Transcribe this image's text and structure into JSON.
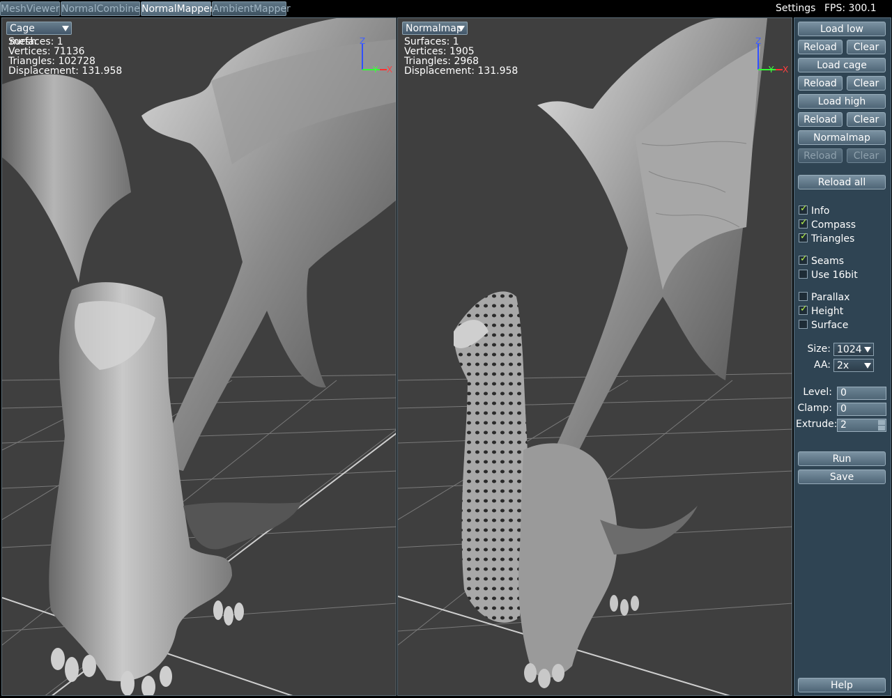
{
  "tabs": [
    {
      "label": "MeshViewer",
      "active": false
    },
    {
      "label": "NormalCombiner",
      "active": false
    },
    {
      "label": "NormalMapper",
      "active": true
    },
    {
      "label": "AmbientMapper",
      "active": false
    }
  ],
  "topbar": {
    "settings_label": "Settings",
    "fps_label": "FPS: 300.1"
  },
  "viewports": {
    "left": {
      "mode": "Cage mesh",
      "info": [
        "Surfaces: 1",
        "Vertices: 71136",
        "Triangles: 102728",
        "Displacement: 131.958"
      ],
      "scene_icon": "dragon-cage-mesh-render"
    },
    "right": {
      "mode": "Normalmap",
      "info": [
        "Surfaces: 1",
        "Vertices: 1905",
        "Triangles: 2968",
        "Displacement: 131.958"
      ],
      "scene_icon": "dragon-normalmapped-render"
    },
    "compass_labels": {
      "z": "Z",
      "y": "Y",
      "x": "X"
    }
  },
  "panel": {
    "buttons": {
      "load_low": "Load low",
      "reload_1": "Reload",
      "clear_1": "Clear",
      "load_cage": "Load cage",
      "reload_2": "Reload",
      "clear_2": "Clear",
      "load_high": "Load high",
      "reload_3": "Reload",
      "clear_3": "Clear",
      "normalmap": "Normalmap",
      "reload_4": "Reload",
      "clear_4": "Clear",
      "reload_all": "Reload all",
      "run": "Run",
      "save": "Save",
      "help": "Help"
    },
    "checkboxes": [
      {
        "label": "Info",
        "checked": true
      },
      {
        "label": "Compass",
        "checked": true
      },
      {
        "label": "Triangles",
        "checked": true
      },
      {
        "label": "Seams",
        "checked": true
      },
      {
        "label": "Use 16bit",
        "checked": false
      },
      {
        "label": "Parallax",
        "checked": false
      },
      {
        "label": "Height",
        "checked": true
      },
      {
        "label": "Surface",
        "checked": false
      }
    ],
    "size": {
      "label": "Size:",
      "value": "1024"
    },
    "aa": {
      "label": "AA:",
      "value": "2x"
    },
    "level": {
      "label": "Level:",
      "value": "0"
    },
    "clamp": {
      "label": "Clamp:",
      "value": "0"
    },
    "extrude": {
      "label": "Extrude:",
      "value": "2"
    }
  },
  "colors": {
    "panel_bg": "#2f4453",
    "viewport_bg": "#3f3f3f",
    "check_tick": "#b8f54a",
    "axis_x": "#ff3030",
    "axis_y": "#30ff30",
    "axis_z": "#3050ff"
  }
}
